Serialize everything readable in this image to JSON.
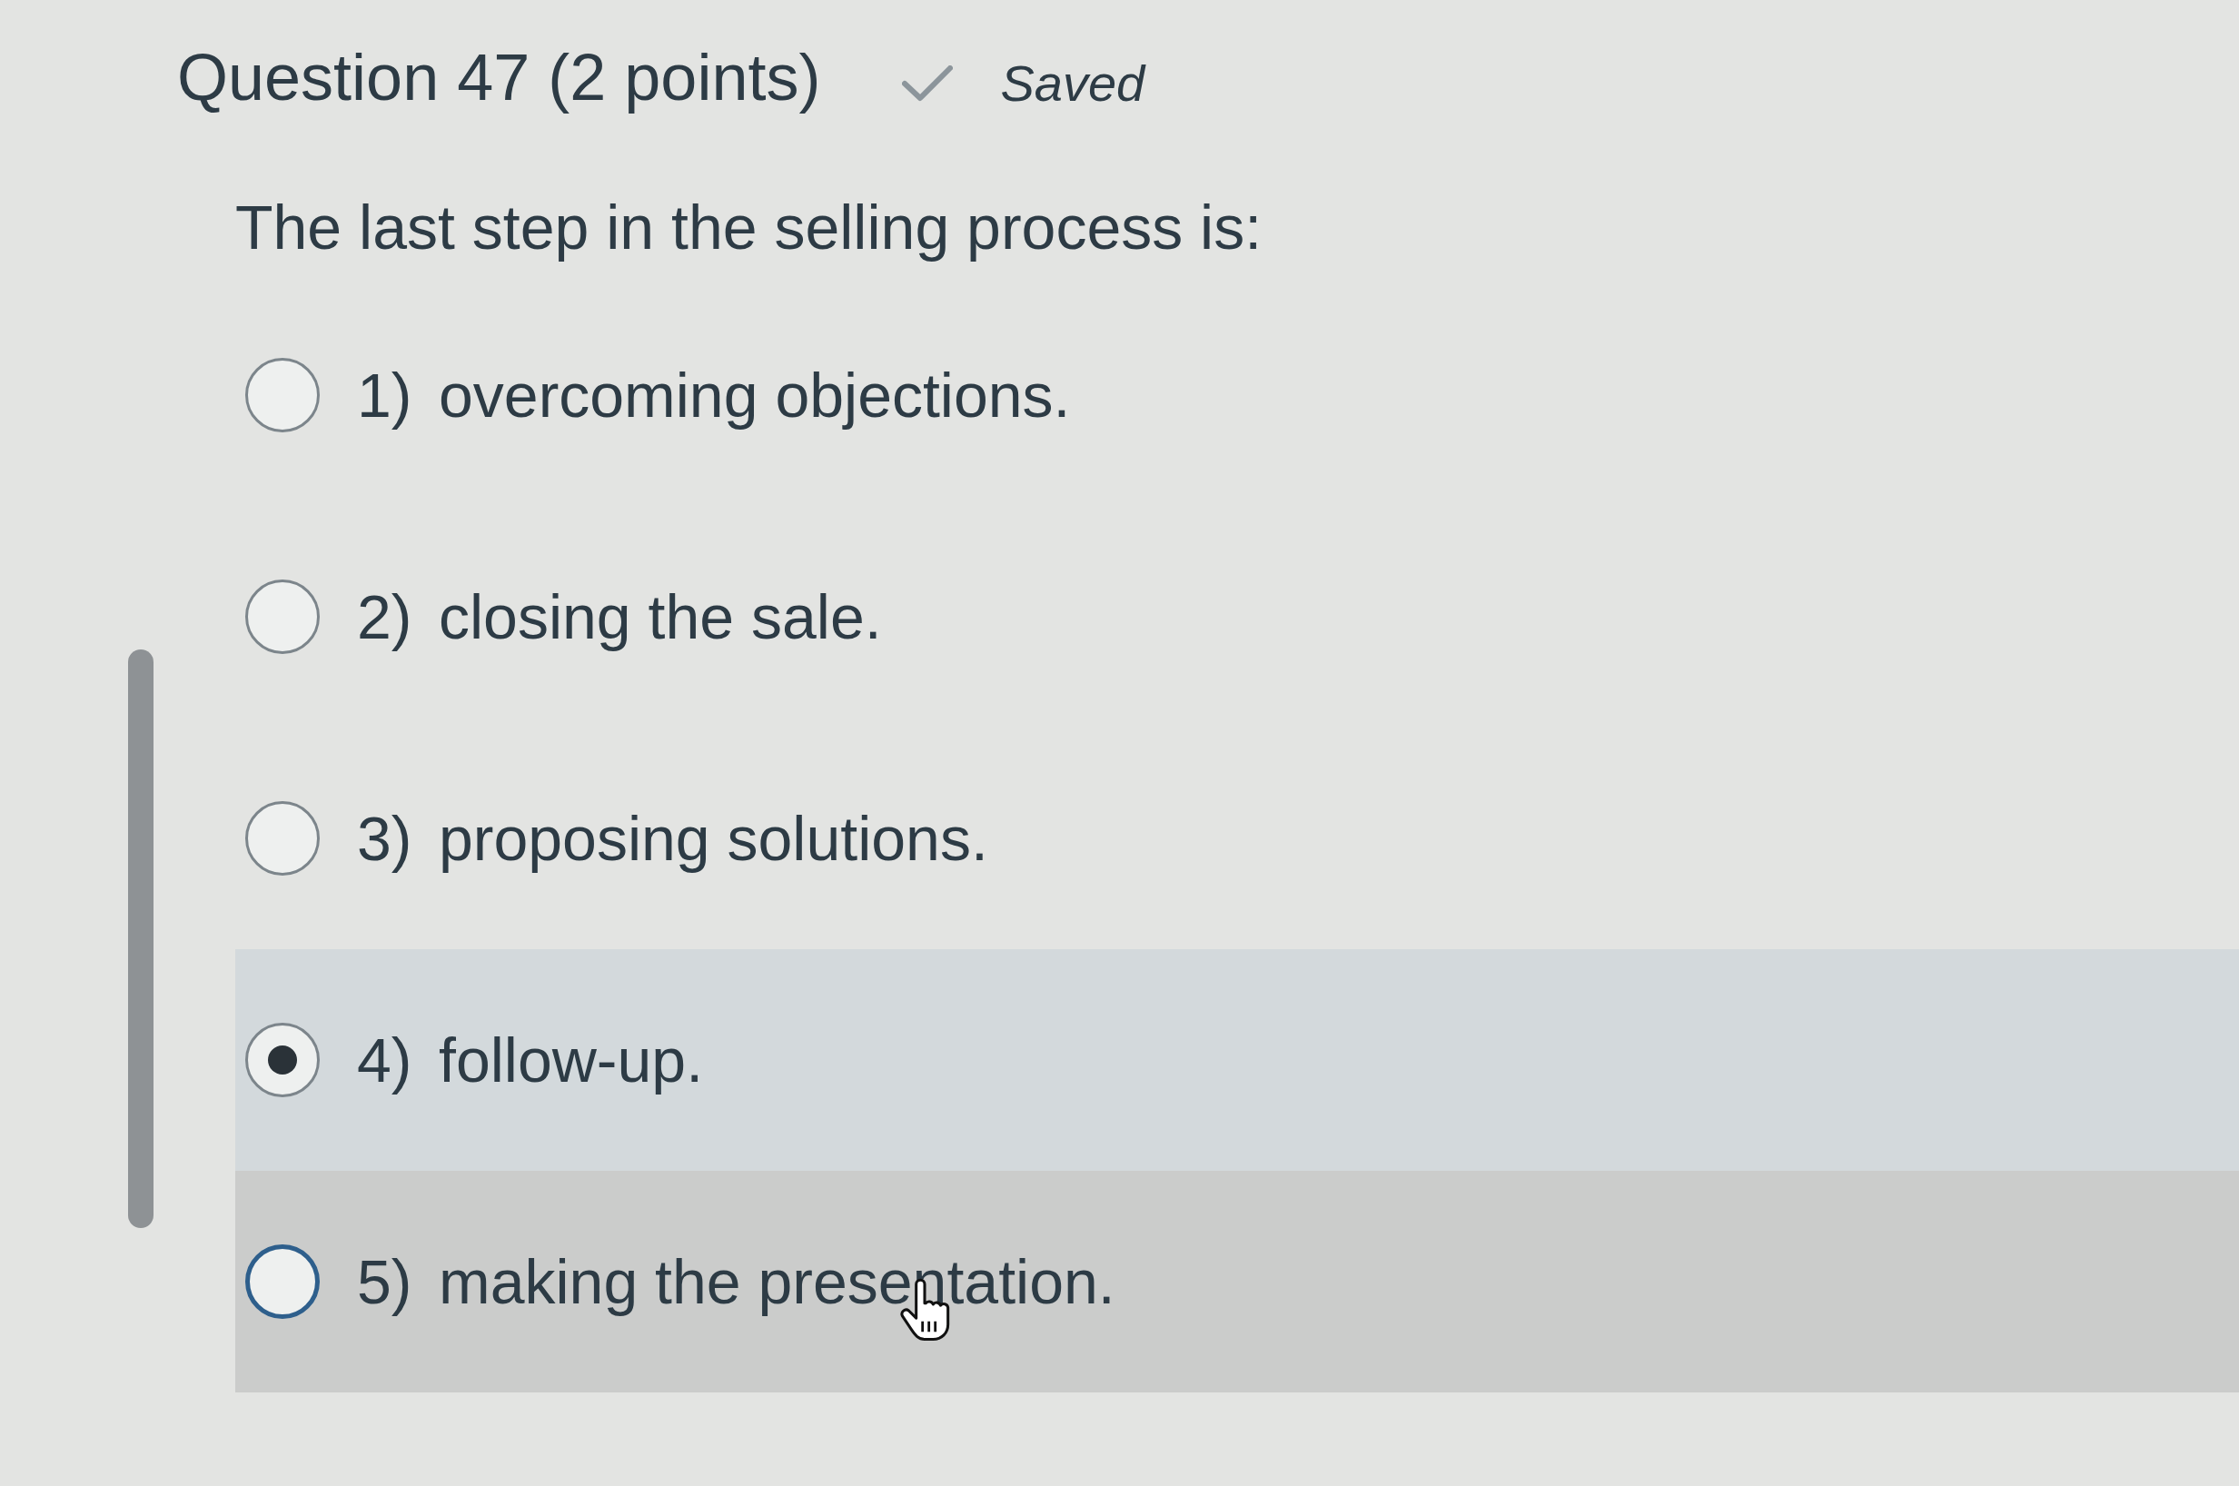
{
  "question": {
    "title": "Question 47 (2 points)",
    "save_status": "Saved",
    "prompt": "The last step in the selling process is:"
  },
  "options": [
    {
      "number": "1)",
      "text": "overcoming objections.",
      "selected": false,
      "hovered": false
    },
    {
      "number": "2)",
      "text": "closing the sale.",
      "selected": false,
      "hovered": false
    },
    {
      "number": "3)",
      "text": "proposing solutions.",
      "selected": false,
      "hovered": false
    },
    {
      "number": "4)",
      "text": "follow-up.",
      "selected": true,
      "hovered": false
    },
    {
      "number": "5)",
      "text": "making the presentation.",
      "selected": false,
      "hovered": true
    }
  ]
}
